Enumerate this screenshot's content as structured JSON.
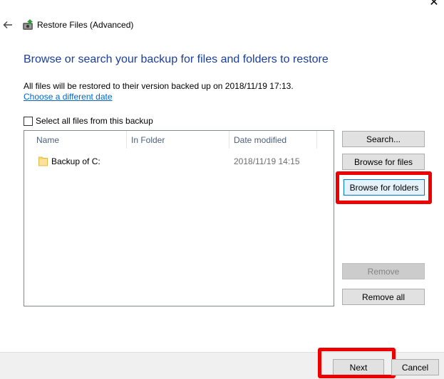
{
  "window": {
    "title": "Restore Files (Advanced)",
    "close_glyph": "✕",
    "back_icon": "back-arrow-icon",
    "app_icon": "restore-files-icon"
  },
  "main": {
    "heading": "Browse or search your backup for files and folders to restore",
    "info_text": "All files will be restored to their version backed up on 2018/11/19 17:13.",
    "change_date_link": "Choose a different date",
    "select_all_label": "Select all files from this backup",
    "select_all_checked": false
  },
  "list": {
    "columns": [
      "Name",
      "In Folder",
      "Date modified"
    ],
    "rows": [
      {
        "name": "Backup of C:",
        "in_folder": "",
        "date_modified": "2018/11/19 14:15",
        "icon": "folder-icon"
      }
    ]
  },
  "side_buttons": {
    "search": "Search...",
    "browse_files": "Browse for files",
    "browse_folders": "Browse for folders",
    "remove": "Remove",
    "remove_all": "Remove all"
  },
  "footer": {
    "next": "Next",
    "cancel": "Cancel"
  },
  "colors": {
    "heading": "#1a3e9a",
    "link": "#0066cc",
    "highlight": "#ee0000",
    "focused_button_border": "#0078d7"
  }
}
